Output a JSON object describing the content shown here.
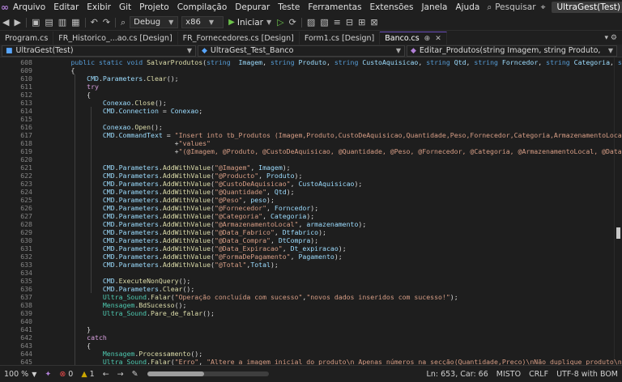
{
  "menu": {
    "items": [
      "Arquivo",
      "Editar",
      "Exibir",
      "Git",
      "Projeto",
      "Compilação",
      "Depurar",
      "Teste",
      "Ferramentas",
      "Extensões",
      "Janela",
      "Ajuda"
    ],
    "search_label": "Pesquisar",
    "window_title": "UltraGest(Test)"
  },
  "toolbar": {
    "config": "Debug",
    "platform": "x86",
    "start_label": "Iniciar"
  },
  "tabs": [
    {
      "label": "Program.cs",
      "active": false
    },
    {
      "label": "FR_Historico_...ao.cs [Design]",
      "active": false
    },
    {
      "label": "FR_Fornecedores.cs [Design]",
      "active": false
    },
    {
      "label": "Form1.cs [Design]",
      "active": false
    },
    {
      "label": "Banco.cs",
      "active": true
    }
  ],
  "navbar": {
    "project": "UltraGest(Test)",
    "class": "UltraGest_Test_Banco",
    "member": "Editar_Produtos(string Imagem, string Produto, string CustoAquisicao"
  },
  "code_lines": [
    {
      "n": "608",
      "html": "        <span class=\"kw\">public static void</span> <span class=\"fn\">SalvarProdutos</span><span class=\"pl\">(</span><span class=\"kw\">string</span>  <span class=\"id\">Imagem</span><span class=\"pl\">, </span><span class=\"kw\">string</span> <span class=\"id\">Produto</span><span class=\"pl\">, </span><span class=\"kw\">string</span> <span class=\"id\">CustoAquisicao</span><span class=\"pl\">, </span><span class=\"kw\">string</span> <span class=\"id\">Qtd</span><span class=\"pl\">, </span><span class=\"kw\">string</span> <span class=\"id\">Forncedor</span><span class=\"pl\">, </span><span class=\"kw\">string</span> <span class=\"id\">Categoria</span><span class=\"pl\">, </span><span class=\"kw\">string</span> <span class=\"id\">Dtf</span>"
    },
    {
      "n": "609",
      "html": "        <span class=\"pl\">{</span>"
    },
    {
      "n": "610",
      "html": "            <span class=\"id\">CMD</span><span class=\"pl\">.</span><span class=\"id\">Parameters</span><span class=\"pl\">.</span><span class=\"fn\">Clear</span><span class=\"pl\">();</span>"
    },
    {
      "n": "611",
      "html": "            <span class=\"ctl\">try</span>"
    },
    {
      "n": "612",
      "html": "            <span class=\"pl\">{</span>"
    },
    {
      "n": "613",
      "html": "                <span class=\"id\">Conexao</span><span class=\"pl\">.</span><span class=\"fn\">Close</span><span class=\"pl\">();</span>"
    },
    {
      "n": "614",
      "html": "                <span class=\"id\">CMD</span><span class=\"pl\">.</span><span class=\"id\">Connection</span><span class=\"pl\"> = </span><span class=\"id\">Conexao</span><span class=\"pl\">;</span>"
    },
    {
      "n": "615",
      "html": ""
    },
    {
      "n": "616",
      "html": "                <span class=\"id\">Conexao</span><span class=\"pl\">.</span><span class=\"fn\">Open</span><span class=\"pl\">();</span>"
    },
    {
      "n": "617",
      "html": "                <span class=\"id\">CMD</span><span class=\"pl\">.</span><span class=\"id\">CommandText</span><span class=\"pl\"> = </span><span class=\"st\">\"Insert into tb_Produtos (Imagem,Produto,CustoDeAquisicao,Quantidade,Peso,Fornecedor,Categoria,ArmazenamentoLocal,Data_F</span>"
    },
    {
      "n": "618",
      "html": "                                  <span class=\"pl\">+</span><span class=\"st\">\"values\"</span>"
    },
    {
      "n": "619",
      "html": "                                  <span class=\"pl\">+</span><span class=\"st\">\"(@Imagem, @Produto, @CustoDeAquisicao, @Quantidade, @Peso, @Fornecedor, @Categoria, @ArmazenamentoLocal, @Data_Fabrico</span>"
    },
    {
      "n": "620",
      "html": ""
    },
    {
      "n": "621",
      "html": "                <span class=\"id\">CMD</span><span class=\"pl\">.</span><span class=\"id\">Parameters</span><span class=\"pl\">.</span><span class=\"fn\">AddWithValue</span><span class=\"pl\">(</span><span class=\"st\">\"@Imagem\"</span><span class=\"pl\">, </span><span class=\"id\">Imagem</span><span class=\"pl\">);</span>"
    },
    {
      "n": "622",
      "html": "                <span class=\"id\">CMD</span><span class=\"pl\">.</span><span class=\"id\">Parameters</span><span class=\"pl\">.</span><span class=\"fn\">AddWithValue</span><span class=\"pl\">(</span><span class=\"st\">\"@Producto\"</span><span class=\"pl\">, </span><span class=\"id\">Produto</span><span class=\"pl\">);</span>"
    },
    {
      "n": "623",
      "html": "                <span class=\"id\">CMD</span><span class=\"pl\">.</span><span class=\"id\">Parameters</span><span class=\"pl\">.</span><span class=\"fn\">AddWithValue</span><span class=\"pl\">(</span><span class=\"st\">\"@CustoDeAquisicao\"</span><span class=\"pl\">, </span><span class=\"id\">CustoAquisicao</span><span class=\"pl\">);</span>"
    },
    {
      "n": "624",
      "html": "                <span class=\"id\">CMD</span><span class=\"pl\">.</span><span class=\"id\">Parameters</span><span class=\"pl\">.</span><span class=\"fn\">AddWithValue</span><span class=\"pl\">(</span><span class=\"st\">\"@Quantidade\"</span><span class=\"pl\">, </span><span class=\"id\">Qtd</span><span class=\"pl\">);</span>"
    },
    {
      "n": "625",
      "html": "                <span class=\"id\">CMD</span><span class=\"pl\">.</span><span class=\"id\">Parameters</span><span class=\"pl\">.</span><span class=\"fn\">AddWithValue</span><span class=\"pl\">(</span><span class=\"st\">\"@Peso\"</span><span class=\"pl\">, </span><span class=\"id\">peso</span><span class=\"pl\">);</span>"
    },
    {
      "n": "626",
      "html": "                <span class=\"id\">CMD</span><span class=\"pl\">.</span><span class=\"id\">Parameters</span><span class=\"pl\">.</span><span class=\"fn\">AddWithValue</span><span class=\"pl\">(</span><span class=\"st\">\"@Fornecedor\"</span><span class=\"pl\">, </span><span class=\"id\">Forncedor</span><span class=\"pl\">);</span>"
    },
    {
      "n": "627",
      "html": "                <span class=\"id\">CMD</span><span class=\"pl\">.</span><span class=\"id\">Parameters</span><span class=\"pl\">.</span><span class=\"fn\">AddWithValue</span><span class=\"pl\">(</span><span class=\"st\">\"@Categoria\"</span><span class=\"pl\">, </span><span class=\"id\">Categoria</span><span class=\"pl\">);</span>"
    },
    {
      "n": "628",
      "html": "                <span class=\"id\">CMD</span><span class=\"pl\">.</span><span class=\"id\">Parameters</span><span class=\"pl\">.</span><span class=\"fn\">AddWithValue</span><span class=\"pl\">(</span><span class=\"st\">\"@ArmazenamentoLocal\"</span><span class=\"pl\">, </span><span class=\"id\">armazenamento</span><span class=\"pl\">);</span>"
    },
    {
      "n": "629",
      "html": "                <span class=\"id\">CMD</span><span class=\"pl\">.</span><span class=\"id\">Parameters</span><span class=\"pl\">.</span><span class=\"fn\">AddWithValue</span><span class=\"pl\">(</span><span class=\"st\">\"@Data_Fabrico\"</span><span class=\"pl\">, </span><span class=\"id\">Dtfabrico</span><span class=\"pl\">);</span>"
    },
    {
      "n": "630",
      "html": "                <span class=\"id\">CMD</span><span class=\"pl\">.</span><span class=\"id\">Parameters</span><span class=\"pl\">.</span><span class=\"fn\">AddWithValue</span><span class=\"pl\">(</span><span class=\"st\">\"@Data_Compra\"</span><span class=\"pl\">, </span><span class=\"id\">DtCompra</span><span class=\"pl\">);</span>"
    },
    {
      "n": "631",
      "html": "                <span class=\"id\">CMD</span><span class=\"pl\">.</span><span class=\"id\">Parameters</span><span class=\"pl\">.</span><span class=\"fn\">AddWithValue</span><span class=\"pl\">(</span><span class=\"st\">\"@Data_Expiracao\"</span><span class=\"pl\">, </span><span class=\"id\">Dt_expiracao</span><span class=\"pl\">);</span>"
    },
    {
      "n": "632",
      "html": "                <span class=\"id\">CMD</span><span class=\"pl\">.</span><span class=\"id\">Parameters</span><span class=\"pl\">.</span><span class=\"fn\">AddWithValue</span><span class=\"pl\">(</span><span class=\"st\">\"@FormaDePagamento\"</span><span class=\"pl\">, </span><span class=\"id\">Pagamento</span><span class=\"pl\">);</span>"
    },
    {
      "n": "633",
      "html": "                <span class=\"id\">CMD</span><span class=\"pl\">.</span><span class=\"id\">Parameters</span><span class=\"pl\">.</span><span class=\"fn\">AddWithValue</span><span class=\"pl\">(</span><span class=\"st\">\"@Total\"</span><span class=\"pl\">,</span><span class=\"id\">Total</span><span class=\"pl\">);</span>"
    },
    {
      "n": "634",
      "html": ""
    },
    {
      "n": "635",
      "html": "                <span class=\"id\">CMD</span><span class=\"pl\">.</span><span class=\"fn\">ExecuteNonQuery</span><span class=\"pl\">();</span>"
    },
    {
      "n": "636",
      "html": "                <span class=\"id\">CMD</span><span class=\"pl\">.</span><span class=\"id\">Parameters</span><span class=\"pl\">.</span><span class=\"fn\">Clear</span><span class=\"pl\">();</span>"
    },
    {
      "n": "637",
      "html": "                <span class=\"ty\">Ultra_Sound</span><span class=\"pl\">.</span><span class=\"fn\">Falar</span><span class=\"pl\">(</span><span class=\"st\">\"Operação concluída com sucesso\"</span><span class=\"pl\">,</span><span class=\"st\">\"novos dados inseridos com sucesso!\"</span><span class=\"pl\">);</span>"
    },
    {
      "n": "638",
      "html": "                <span class=\"ty\">Mensagem</span><span class=\"pl\">.</span><span class=\"fn\">BdSucesso</span><span class=\"pl\">();</span>"
    },
    {
      "n": "639",
      "html": "                <span class=\"ty\">Ultra_Sound</span><span class=\"pl\">.</span><span class=\"fn\">Pare_de_falar</span><span class=\"pl\">();</span>"
    },
    {
      "n": "640",
      "html": ""
    },
    {
      "n": "641",
      "html": "            <span class=\"pl\">}</span>"
    },
    {
      "n": "642",
      "html": "            <span class=\"ctl\">catch</span>"
    },
    {
      "n": "643",
      "html": "            <span class=\"pl\">{</span>"
    },
    {
      "n": "644",
      "html": "                <span class=\"ty\">Mensagem</span><span class=\"pl\">.</span><span class=\"fn\">Processamento</span><span class=\"pl\">();</span>"
    },
    {
      "n": "645",
      "html": "                <span class=\"ty\">Ultra_Sound</span><span class=\"pl\">.</span><span class=\"fn\">Falar</span><span class=\"pl\">(</span><span class=\"st\">\"Erro\"</span><span class=\"pl\">, </span><span class=\"st\">\"Altere a imagem inicial do produto\\n Apenas números na secção(Quantidade,Preco)\\nNão duplique produto\\nPreenca t</span>"
    }
  ],
  "status": {
    "zoom": "100 %",
    "errors": "0",
    "warnings": "1",
    "position": "Ln: 653, Car: 66",
    "whitespace": "MISTO",
    "line_ending": "CRLF",
    "encoding": "UTF-8 with BOM"
  }
}
